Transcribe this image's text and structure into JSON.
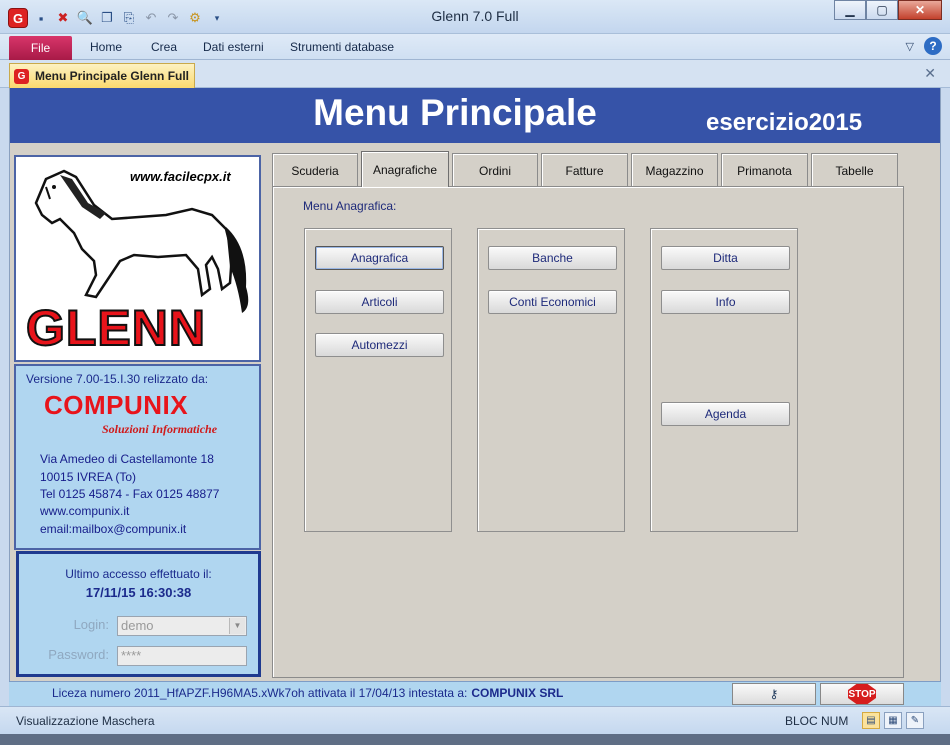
{
  "window": {
    "title": "Glenn 7.0 Full",
    "minimize_glyph": "▁",
    "maximize_glyph": "▢",
    "close_glyph": "✕"
  },
  "app_logo_letter": "G",
  "quick_access_icons": [
    "save-icon",
    "close-db-icon",
    "print-preview-icon",
    "copy-icon",
    "export-icon",
    "undo-icon",
    "redo-icon",
    "tools-icon",
    "customize-qat-icon"
  ],
  "ribbon": {
    "file_label": "File",
    "tabs": [
      "Home",
      "Crea",
      "Dati esterni",
      "Strumenti database"
    ],
    "help_glyph": "?",
    "collapse_glyph": "▽"
  },
  "document_tab": {
    "label": "Menu Principale Glenn Full",
    "close_glyph": "✕"
  },
  "header": {
    "title": "Menu Principale",
    "year_prefix": "esercizio",
    "year": "2015",
    "color": "#3653a8"
  },
  "logo": {
    "site": "www.facilecpx.it",
    "brand": "GLENN"
  },
  "info": {
    "version_line": "Versione  7.00-15.I.30  relizzato da:",
    "company": "COMPUNIX",
    "company_sub": "Soluzioni Informatiche",
    "address1": "Via Amedeo di Castellamonte 18",
    "address2": "10015   IVREA    (To)",
    "phone": "Tel 0125 45874 - Fax 0125 48877",
    "web": "www.compunix.it",
    "email": "email:mailbox@compunix.it"
  },
  "access": {
    "label": "Ultimo accesso effettuato il:",
    "datetime": "17/11/15 16:30:38",
    "login_label": "Login:",
    "login_value": "demo",
    "password_label": "Password:",
    "password_value": "****"
  },
  "tabs": [
    "Scuderia",
    "Anagrafiche",
    "Ordini",
    "Fatture",
    "Magazzino",
    "Primanota",
    "Tabelle"
  ],
  "active_tab": "Anagrafiche",
  "panel": {
    "title": "Menu Anagrafica:",
    "col1": [
      "Anagrafica",
      "Articoli",
      "Automezzi"
    ],
    "col2": [
      "Banche",
      "Conti Economici"
    ],
    "col3": [
      "Ditta",
      "Info",
      "Agenda"
    ]
  },
  "license": {
    "text": "Liceza numero 2011_HfAPZF.H96MA5.xWk7oh attivata il 17/04/13 intestata a:",
    "owner": "COMPUNIX SRL",
    "key_glyph": "⚷",
    "stop_label": "STOP"
  },
  "status": {
    "left": "Visualizzazione Maschera",
    "numlock": "BLOC NUM"
  }
}
